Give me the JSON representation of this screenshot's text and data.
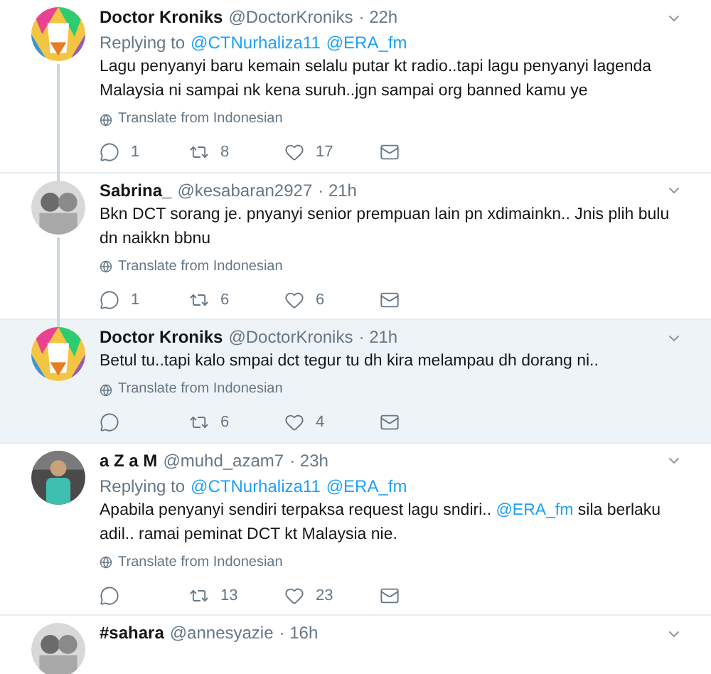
{
  "tweets": [
    {
      "name": "Doctor Kroniks",
      "handle": "@DoctorKroniks",
      "time": "· 22h",
      "highlighted": false,
      "thread_below": true,
      "replying_label": "Replying to",
      "replying_to": [
        "@CTNurhaliza11",
        "@ERA_fm"
      ],
      "text": [
        {
          "kind": "plain",
          "text": "Lagu penyanyi baru kemain selalu putar kt radio..tapi lagu penyanyi lagenda Malaysia ni sampai nk kena suruh..jgn sampai org banned kamu ye"
        }
      ],
      "translate": "Translate from Indonesian",
      "replies": "1",
      "retweets": "8",
      "likes": "17"
    },
    {
      "name": "Sabrina_",
      "handle": "@kesabaran2927",
      "time": "· 21h",
      "highlighted": false,
      "thread_below": true,
      "text": [
        {
          "kind": "plain",
          "text": "Bkn DCT sorang je. pnyanyi senior prempuan lain pn xdimainkn.. Jnis plih bulu dn naikkn bbnu"
        }
      ],
      "translate": "Translate from Indonesian",
      "replies": "1",
      "retweets": "6",
      "likes": "6"
    },
    {
      "name": "Doctor Kroniks",
      "handle": "@DoctorKroniks",
      "time": "· 21h",
      "highlighted": true,
      "thread_below": false,
      "text": [
        {
          "kind": "plain",
          "text": "Betul tu..tapi kalo smpai dct tegur tu dh kira melampau dh dorang ni.."
        }
      ],
      "translate": "Translate from Indonesian",
      "retweets": "6",
      "likes": "4"
    },
    {
      "name": "a Z a M",
      "handle": "@muhd_azam7",
      "time": "· 23h",
      "highlighted": false,
      "thread_below": false,
      "replying_label": "Replying to",
      "replying_to": [
        "@CTNurhaliza11",
        "@ERA_fm"
      ],
      "text": [
        {
          "kind": "plain",
          "text": "Apabila penyanyi sendiri terpaksa request lagu sndiri.. "
        },
        {
          "kind": "mention",
          "text": "@ERA_fm"
        },
        {
          "kind": "plain",
          "text": " sila berlaku adil.. ramai peminat DCT kt Malaysia nie."
        }
      ],
      "translate": "Translate from Indonesian",
      "retweets": "13",
      "likes": "23"
    },
    {
      "name": "#sahara",
      "handle": "@annesyazie",
      "time": "· 16h",
      "highlighted": false,
      "thread_below": false
    }
  ]
}
